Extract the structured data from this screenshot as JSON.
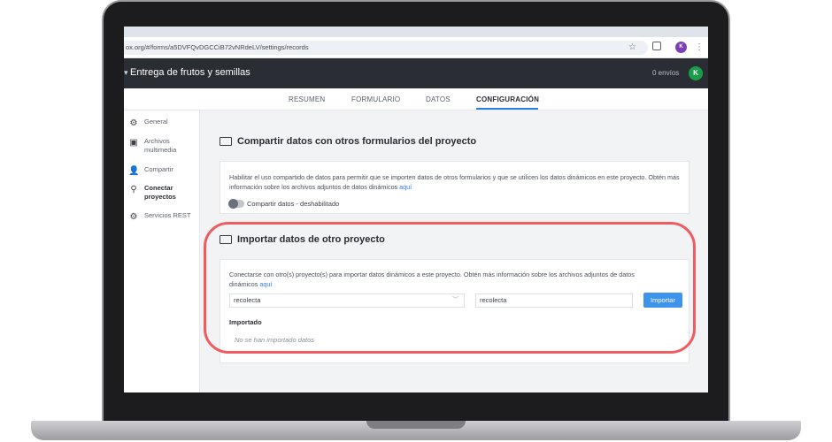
{
  "browser": {
    "url": "ox.org/#/forms/a5DVFQvDGCCiB72vNRdeLV/settings/records",
    "profile_initial": "K"
  },
  "app": {
    "title": "Entrega de frutos y semillas",
    "submissions": "0 envíos",
    "avatar_initial": "K",
    "avatar_color": "#1a9d48"
  },
  "tabs": [
    {
      "label": "RESUMEN"
    },
    {
      "label": "FORMULARIO"
    },
    {
      "label": "DATOS"
    },
    {
      "label": "CONFIGURACIÓN",
      "active": true
    }
  ],
  "sidebar": {
    "items": [
      {
        "label": "General",
        "icon": "gear-icon"
      },
      {
        "label": "Archivos multimedia",
        "icon": "image-icon"
      },
      {
        "label": "Compartir",
        "icon": "add-user-icon"
      },
      {
        "label": "Conectar proyectos",
        "icon": "paperclip-icon",
        "active": true
      },
      {
        "label": "Servicios REST",
        "icon": "rest-services-icon"
      }
    ]
  },
  "share_section": {
    "title": "Compartir datos con otros formularios del proyecto",
    "description": "Habilitar el uso compartido de datos para permitir que se importen datos de otros formularios y que se utilicen los datos dinámicos en este proyecto. Obtén más información sobre los archivos adjuntos de datos dinámicos",
    "link": "aquí",
    "toggle_label": "Compartir datos - deshabilitado",
    "toggle_enabled": false
  },
  "import_section": {
    "title": "Importar datos de otro proyecto",
    "description": "Conectarse con otro(s) proyecto(s) para importar datos dinámicos a este proyecto. Obtén más información sobre los archivos adjuntos de datos dinámicos",
    "link": "aquí",
    "project_select": "recolecta",
    "filename_value": "recolecta",
    "import_button": "Importar",
    "imported_heading": "Importado",
    "imported_empty": "No se han importado datos"
  },
  "colors": {
    "accent": "#2f7de1",
    "button": "#3e94ea",
    "highlight": "#ef5b5f",
    "header": "#2a2d33"
  }
}
